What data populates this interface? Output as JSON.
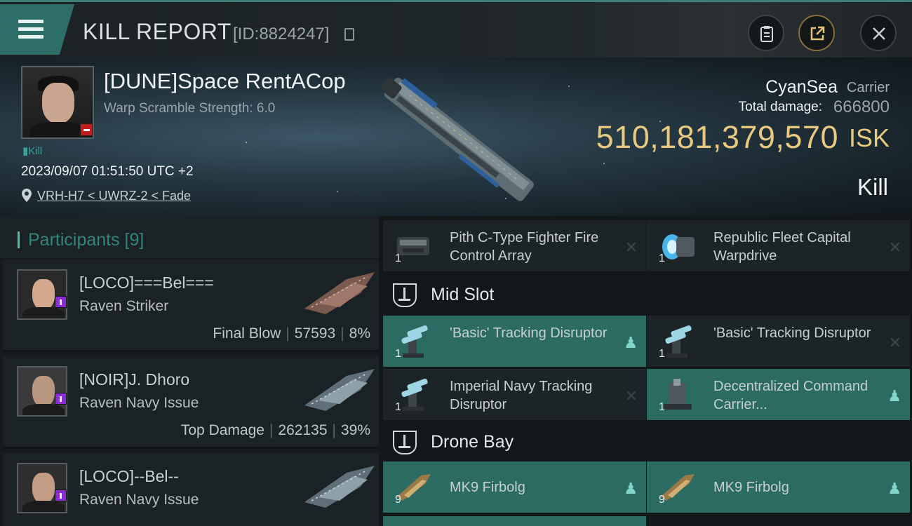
{
  "header": {
    "title": "KILL REPORT",
    "report_id": "[ID:8824247]"
  },
  "victim": {
    "name": "[DUNE]Space RentACop",
    "warp_scramble": "Warp Scramble Strength: 6.0",
    "tag": "Kill",
    "datetime": "2023/09/07 01:51:50 UTC +2",
    "location": "VRH-H7 < UWRZ-2 < Fade",
    "ship_name": "CyanSea",
    "ship_class": "Carrier",
    "total_damage_label": "Total damage:",
    "total_damage": "666800",
    "isk_value": "510,181,379,570",
    "isk_unit": "ISK",
    "kill_type": "Kill"
  },
  "participants": {
    "title": "Participants [9]",
    "list": [
      {
        "name": "[LOCO]===Bel===",
        "ship": "Raven Striker",
        "stat_label": "Final Blow",
        "damage": "57593",
        "percent": "8%"
      },
      {
        "name": "[NOIR]J. Dhoro",
        "ship": "Raven Navy Issue",
        "stat_label": "Top Damage",
        "damage": "262135",
        "percent": "39%"
      },
      {
        "name": "[LOCO]--Bel--",
        "ship": "Raven Navy Issue",
        "stat_label": "",
        "damage": "",
        "percent": ""
      }
    ]
  },
  "items": {
    "top_row": [
      {
        "name": "Pith C-Type Fighter Fire Control Array",
        "qty": "1",
        "status": "destroyed",
        "icon": "fighter-control-icon"
      },
      {
        "name": "Republic Fleet Capital Warpdrive",
        "qty": "1",
        "status": "destroyed",
        "icon": "warpdrive-icon"
      }
    ],
    "mid_slot_label": "Mid Slot",
    "mid_slot": [
      {
        "name": "'Basic' Tracking Disruptor",
        "qty": "1",
        "status": "dropped",
        "icon": "tracking-disruptor-icon"
      },
      {
        "name": "'Basic' Tracking Disruptor",
        "qty": "1",
        "status": "destroyed",
        "icon": "tracking-disruptor-icon"
      },
      {
        "name": "Imperial Navy Tracking Disruptor",
        "qty": "1",
        "status": "destroyed",
        "icon": "tracking-disruptor-icon"
      },
      {
        "name": "Decentralized Command Carrier...",
        "qty": "1",
        "status": "dropped",
        "icon": "command-module-icon"
      }
    ],
    "drone_bay_label": "Drone Bay",
    "drone_bay": [
      {
        "name": "MK9 Firbolg",
        "qty": "9",
        "status": "dropped",
        "icon": "fighter-icon"
      },
      {
        "name": "MK9 Firbolg",
        "qty": "9",
        "status": "dropped",
        "icon": "fighter-icon"
      }
    ]
  },
  "colors": {
    "accent_teal": "#2c6b62",
    "isk_gold": "#e8c97f",
    "badge_purple": "#8b2bd5",
    "badge_red": "#c21d1d"
  }
}
